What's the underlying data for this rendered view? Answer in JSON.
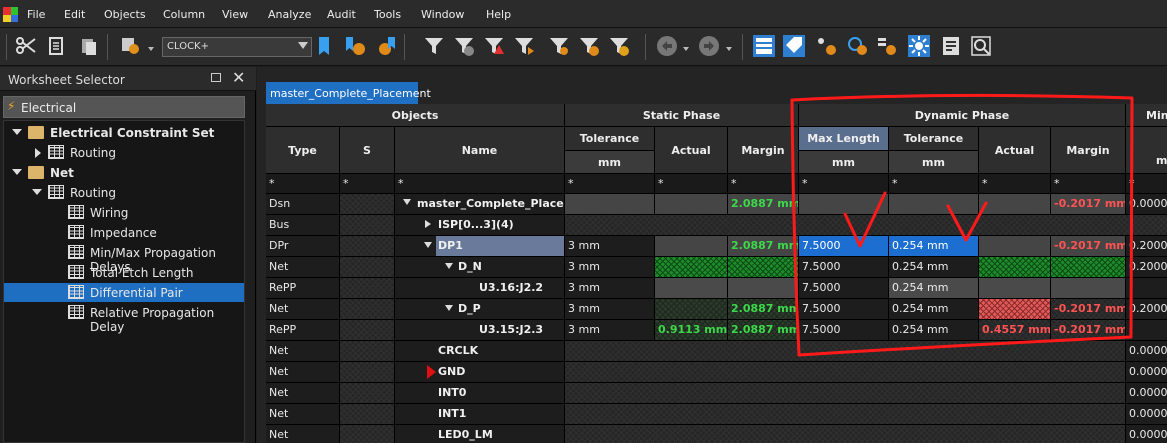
{
  "menu": [
    "File",
    "Edit",
    "Objects",
    "Column",
    "View",
    "Analyze",
    "Audit",
    "Tools",
    "Window",
    "Help"
  ],
  "toolbar": {
    "clock_select": "CLOCK+"
  },
  "panel": {
    "title": "Worksheet Selector",
    "category": "Electrical",
    "tree": [
      {
        "label": "Electrical Constraint Set"
      },
      {
        "label": "Routing"
      },
      {
        "label": "Net"
      },
      {
        "label": "Routing"
      },
      {
        "label": "Wiring"
      },
      {
        "label": "Impedance"
      },
      {
        "label": "Min/Max Propagation Delays"
      },
      {
        "label": "Total Etch Length"
      },
      {
        "label": "Differential Pair"
      },
      {
        "label": "Relative Propagation Delay"
      }
    ]
  },
  "sheet": {
    "tab": "master_Complete_Placement"
  },
  "headers": {
    "objects": "Objects",
    "static_phase": "Static Phase",
    "dynamic_phase": "Dynamic Phase",
    "min_spacing": "Min Spa",
    "type": "Type",
    "s": "S",
    "name": "Name",
    "tolerance": "Tolerance",
    "actual": "Actual",
    "margin": "Margin",
    "max_length": "Max Length",
    "tolerance2": "Tolerance",
    "actual2": "Actual",
    "margin2": "Margin",
    "unit_mm": "mm",
    "unit_mm2": "mm",
    "unit_mm3": "mm",
    "unit_m": "m",
    "filter": "*"
  },
  "rows": [
    {
      "type": "Dsn",
      "name": "master_Complete_Place...",
      "st_tol": "",
      "st_act": "",
      "st_mar": "2.0887 mm",
      "dy_max": "",
      "dy_tol": "",
      "dy_act": "",
      "dy_mar": "-0.2017 mm",
      "min": "0.0000"
    },
    {
      "type": "Bus",
      "name": "ISP[0...3](4)",
      "st_tol": "",
      "st_act": "",
      "st_mar": "",
      "dy_max": "",
      "dy_tol": "",
      "dy_act": "",
      "dy_mar": "",
      "min": ""
    },
    {
      "type": "DPr",
      "name": "DP1",
      "st_tol": "3 mm",
      "st_act": "",
      "st_mar": "2.0887 mm",
      "dy_max": "7.5000",
      "dy_tol": "0.254 mm",
      "dy_act": "",
      "dy_mar": "-0.2017 mm",
      "min": "0.2000"
    },
    {
      "type": "Net",
      "name": "D_N",
      "st_tol": "3 mm",
      "st_act": "",
      "st_mar": "",
      "dy_max": "7.5000",
      "dy_tol": "0.254 mm",
      "dy_act": "",
      "dy_mar": "",
      "min": "0.2000"
    },
    {
      "type": "RePP",
      "name": "U3.16:J2.2",
      "st_tol": "3 mm",
      "st_act": "",
      "st_mar": "",
      "dy_max": "7.5000",
      "dy_tol": "0.254 mm",
      "dy_act": "",
      "dy_mar": "",
      "min": ""
    },
    {
      "type": "Net",
      "name": "D_P",
      "st_tol": "3 mm",
      "st_act": "",
      "st_mar": "2.0887 mm",
      "dy_max": "7.5000",
      "dy_tol": "0.254 mm",
      "dy_act": "",
      "dy_mar": "-0.2017 mm",
      "min": "0.2000"
    },
    {
      "type": "RePP",
      "name": "U3.15:J2.3",
      "st_tol": "3 mm",
      "st_act": "0.9113 mm",
      "st_mar": "2.0887 mm",
      "dy_max": "7.5000",
      "dy_tol": "0.254 mm",
      "dy_act": "0.4557 mm",
      "dy_mar": "-0.2017 mm",
      "min": ""
    },
    {
      "type": "Net",
      "name": "CRCLK",
      "min": "0.0000"
    },
    {
      "type": "Net",
      "name": "GND",
      "min": "0.0000"
    },
    {
      "type": "Net",
      "name": "INT0",
      "min": "0.0000"
    },
    {
      "type": "Net",
      "name": "INT1",
      "min": "0.0000"
    },
    {
      "type": "Net",
      "name": "LED0_LM",
      "min": "0.0000"
    }
  ]
}
